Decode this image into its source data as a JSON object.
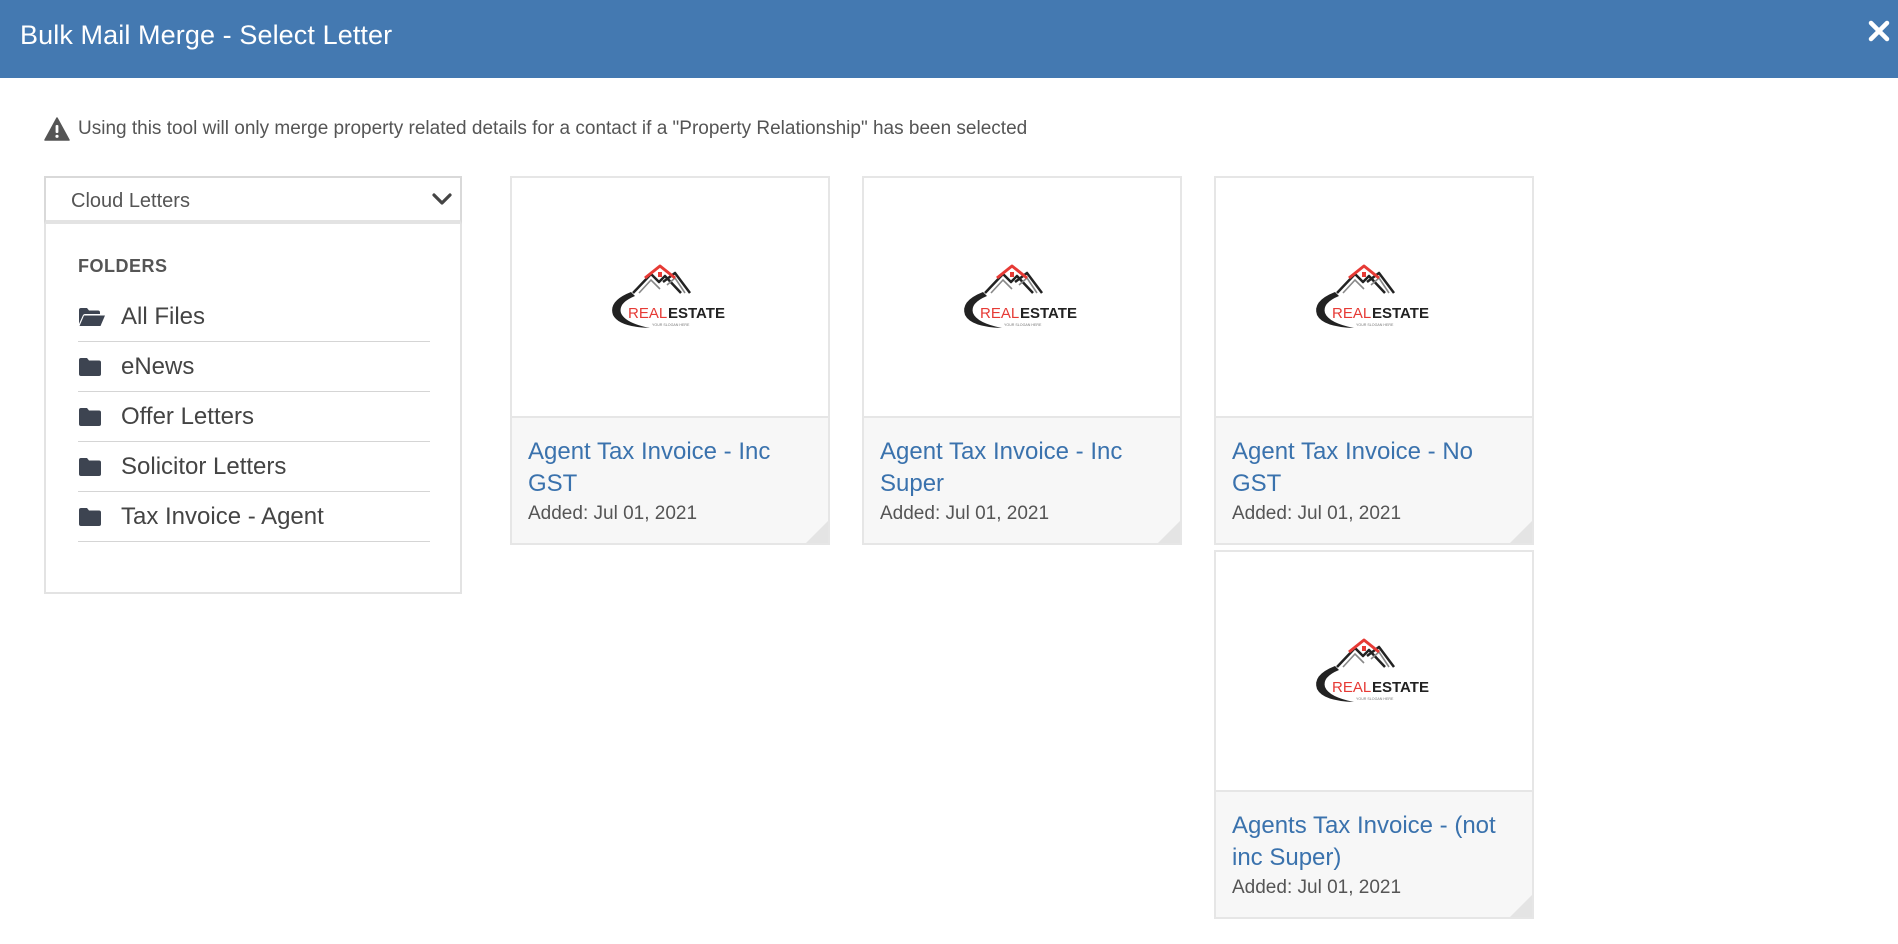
{
  "modal": {
    "title": "Bulk Mail Merge - Select Letter",
    "close_icon": "close-icon"
  },
  "notice": {
    "icon": "warning-icon",
    "text": "Using this tool will only merge property related details for a contact if a \"Property Relationship\" has been selected"
  },
  "source_select": {
    "value": "Cloud Letters",
    "icon": "chevron-down-icon"
  },
  "folders": {
    "heading": "FOLDERS",
    "items": [
      {
        "label": "All Files",
        "icon": "folder-open-icon"
      },
      {
        "label": "eNews",
        "icon": "folder-icon"
      },
      {
        "label": "Offer Letters",
        "icon": "folder-icon"
      },
      {
        "label": "Solicitor Letters",
        "icon": "folder-icon"
      },
      {
        "label": "Tax Invoice - Agent",
        "icon": "folder-icon"
      }
    ]
  },
  "letters": [
    {
      "title": "Agent Tax Invoice - Inc GST",
      "added": "Added: Jul 01, 2021"
    },
    {
      "title": "Agent Tax Invoice - Inc Super",
      "added": "Added: Jul 01, 2021"
    },
    {
      "title": "Agent Tax Invoice - No GST",
      "added": "Added: Jul 01, 2021"
    },
    {
      "title": "Agents Tax Invoice - (not inc Super)",
      "added": "Added: Jul 01, 2021"
    }
  ],
  "logo": {
    "word_red": "REAL",
    "word_dark": "ESTATE",
    "slogan": "YOUR SLOGAN HERE"
  },
  "colors": {
    "header": "#4479b1",
    "link": "#3a72ad",
    "logo_red": "#e63a35",
    "logo_dark": "#222222"
  }
}
